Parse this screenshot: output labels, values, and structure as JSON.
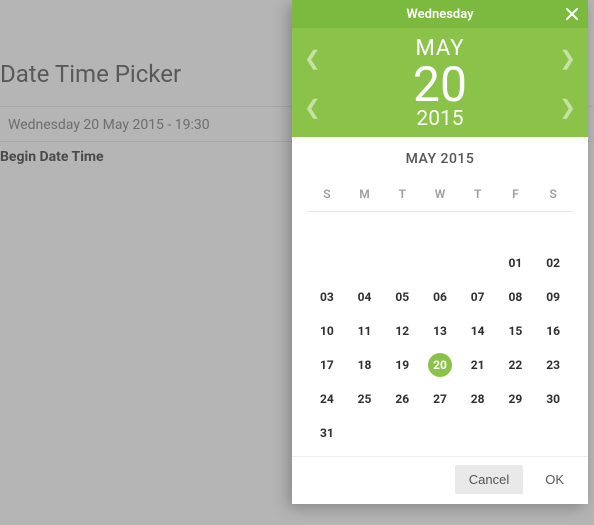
{
  "page": {
    "title": "Date Time Picker",
    "current_value": "Wednesday 20 May 2015 - 19:30",
    "field_label": "Begin Date Time"
  },
  "picker": {
    "weekday": "Wednesday",
    "month": "MAY",
    "day": "20",
    "year": "2015",
    "cal_title": "MAY 2015",
    "dow": [
      "S",
      "M",
      "T",
      "W",
      "T",
      "F",
      "S"
    ],
    "weeks": [
      [
        {
          "d": "",
          "t": "empty"
        },
        {
          "d": "",
          "t": "empty"
        },
        {
          "d": "",
          "t": "empty"
        },
        {
          "d": "",
          "t": "empty"
        },
        {
          "d": "",
          "t": "empty"
        },
        {
          "d": "01",
          "t": "d"
        },
        {
          "d": "02",
          "t": "d"
        }
      ],
      [
        {
          "d": "03",
          "t": "d"
        },
        {
          "d": "04",
          "t": "d"
        },
        {
          "d": "05",
          "t": "d"
        },
        {
          "d": "06",
          "t": "d"
        },
        {
          "d": "07",
          "t": "d"
        },
        {
          "d": "08",
          "t": "d"
        },
        {
          "d": "09",
          "t": "d"
        }
      ],
      [
        {
          "d": "10",
          "t": "d"
        },
        {
          "d": "11",
          "t": "d"
        },
        {
          "d": "12",
          "t": "d"
        },
        {
          "d": "13",
          "t": "d"
        },
        {
          "d": "14",
          "t": "d"
        },
        {
          "d": "15",
          "t": "d"
        },
        {
          "d": "16",
          "t": "d"
        }
      ],
      [
        {
          "d": "17",
          "t": "d"
        },
        {
          "d": "18",
          "t": "d"
        },
        {
          "d": "19",
          "t": "d"
        },
        {
          "d": "20",
          "t": "sel"
        },
        {
          "d": "21",
          "t": "d"
        },
        {
          "d": "22",
          "t": "d"
        },
        {
          "d": "23",
          "t": "d"
        }
      ],
      [
        {
          "d": "24",
          "t": "d"
        },
        {
          "d": "25",
          "t": "d"
        },
        {
          "d": "26",
          "t": "d"
        },
        {
          "d": "27",
          "t": "d"
        },
        {
          "d": "28",
          "t": "d"
        },
        {
          "d": "29",
          "t": "d"
        },
        {
          "d": "30",
          "t": "d"
        }
      ],
      [
        {
          "d": "31",
          "t": "d"
        },
        {
          "d": "",
          "t": "empty"
        },
        {
          "d": "",
          "t": "empty"
        },
        {
          "d": "",
          "t": "empty"
        },
        {
          "d": "",
          "t": "empty"
        },
        {
          "d": "",
          "t": "empty"
        },
        {
          "d": "",
          "t": "empty"
        }
      ]
    ],
    "buttons": {
      "cancel": "Cancel",
      "ok": "OK"
    }
  }
}
